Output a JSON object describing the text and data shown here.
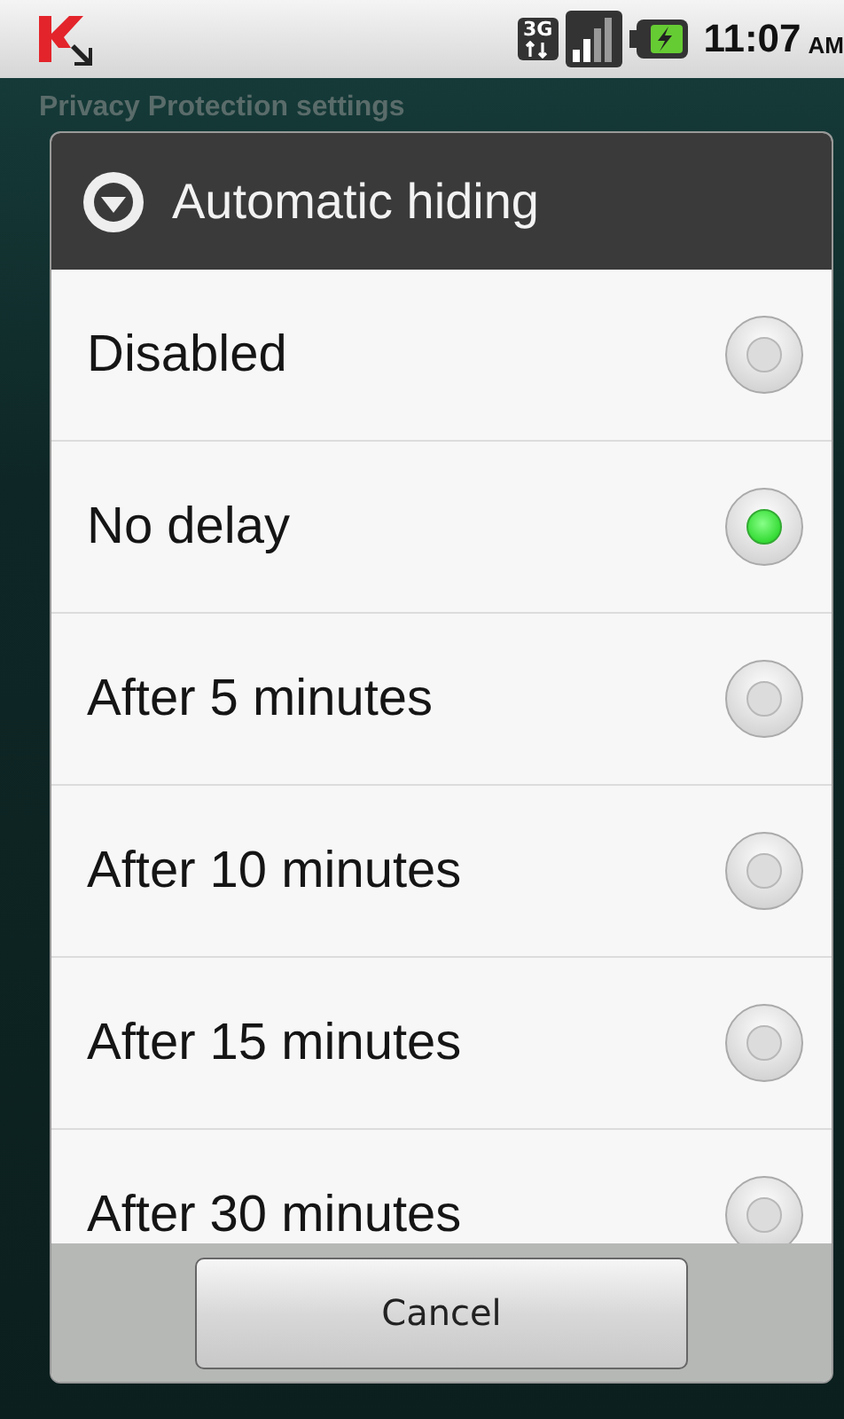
{
  "status_bar": {
    "network": "3G",
    "time": "11:07",
    "meridiem": "AM"
  },
  "screen": {
    "title": "Privacy Protection settings"
  },
  "dialog": {
    "title": "Automatic hiding",
    "options": [
      {
        "label": "Disabled",
        "selected": false
      },
      {
        "label": "No delay",
        "selected": true
      },
      {
        "label": "After 5 minutes",
        "selected": false
      },
      {
        "label": "After 10 minutes",
        "selected": false
      },
      {
        "label": "After 15 minutes",
        "selected": false
      },
      {
        "label": "After 30 minutes",
        "selected": false
      }
    ],
    "buttons": [
      "Cancel"
    ]
  }
}
